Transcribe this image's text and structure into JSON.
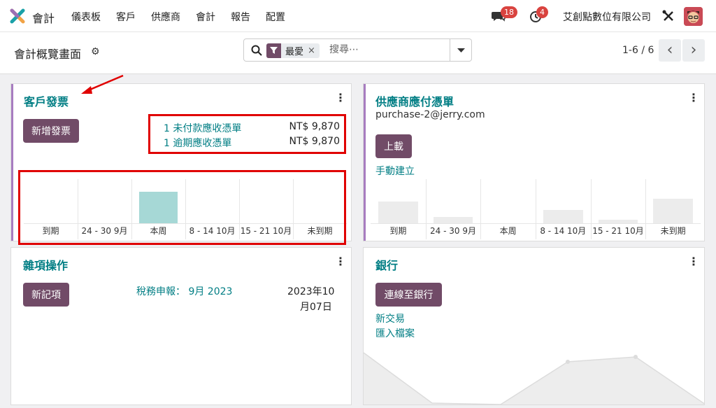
{
  "nav": {
    "app_name": "會計",
    "menu": [
      "儀表板",
      "客戶",
      "供應商",
      "會計",
      "報告",
      "配置"
    ],
    "messages_count": "18",
    "activity_count": "4",
    "company": "艾創點數位有限公司"
  },
  "control": {
    "title": "會計概覽畫面",
    "facet_label": "最愛",
    "facet_close": "×",
    "search_placeholder": "搜尋⋯",
    "pager": "1-6 / 6",
    "prev": "‹",
    "next": "›"
  },
  "cards": {
    "customer_invoices": {
      "title": "客戶發票",
      "menu": "⋮",
      "button": "新增發票",
      "lines": [
        {
          "label": "1 未付款應收憑單",
          "amount": "NT$ 9,870"
        },
        {
          "label": "1 逾期應收憑單",
          "amount": "NT$ 9,870"
        }
      ],
      "chart_labels": [
        "到期",
        "24 - 30 9月",
        "本周",
        "8 - 14 10月",
        "15 - 21 10月",
        "未到期"
      ],
      "chart_values": [
        0,
        0,
        9870,
        0,
        0,
        0
      ]
    },
    "vendor_bills": {
      "title": "供應商應付憑單",
      "menu": "⋮",
      "email": "purchase-2@jerry.com",
      "button": "上載",
      "manual_link": "手動建立",
      "chart_labels": [
        "到期",
        "24 - 30 9月",
        "本周",
        "8 - 14 10月",
        "15 - 21 10月",
        "未到期"
      ],
      "chart_values": [
        30,
        9,
        0,
        19,
        6,
        34
      ]
    },
    "misc": {
      "title": "雜項操作",
      "menu": "⋮",
      "button": "新記項",
      "tax_link": "稅務申報： 9月 2023",
      "date_line1": "2023年10",
      "date_line2": "月07日"
    },
    "bank": {
      "title": "銀行",
      "menu": "⋮",
      "button": "連線至銀行",
      "link_new": "新交易",
      "link_import": "匯入檔案"
    }
  },
  "colors": {
    "primary": "#714b67",
    "link": "#017e84",
    "highlight_bar": "#a6d8d6",
    "placeholder_bar": "#ececec",
    "annotation": "#e00000"
  }
}
